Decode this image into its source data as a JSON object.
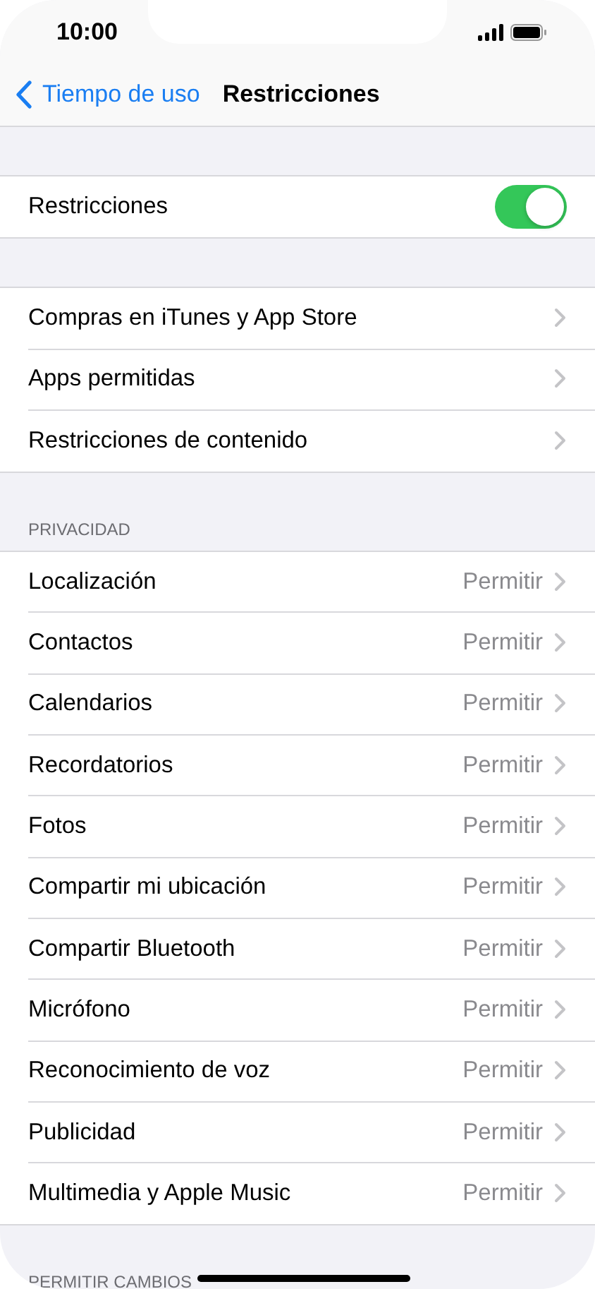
{
  "status_bar": {
    "time": "10:00"
  },
  "nav": {
    "back": "Tiempo de uso",
    "title": "Restricciones"
  },
  "sections": [
    {
      "rows": [
        {
          "kind": "toggle",
          "label": "Restricciones",
          "on": true
        }
      ]
    },
    {
      "rows": [
        {
          "kind": "link",
          "label": "Compras en iTunes y App Store"
        },
        {
          "kind": "link",
          "label": "Apps permitidas"
        },
        {
          "kind": "link",
          "label": "Restricciones de contenido"
        }
      ]
    },
    {
      "header": "PRIVACIDAD",
      "rows": [
        {
          "kind": "link",
          "label": "Localización",
          "value": "Permitir"
        },
        {
          "kind": "link",
          "label": "Contactos",
          "value": "Permitir"
        },
        {
          "kind": "link",
          "label": "Calendarios",
          "value": "Permitir"
        },
        {
          "kind": "link",
          "label": "Recordatorios",
          "value": "Permitir"
        },
        {
          "kind": "link",
          "label": "Fotos",
          "value": "Permitir"
        },
        {
          "kind": "link",
          "label": "Compartir mi ubicación",
          "value": "Permitir"
        },
        {
          "kind": "link",
          "label": "Compartir Bluetooth",
          "value": "Permitir"
        },
        {
          "kind": "link",
          "label": "Micrófono",
          "value": "Permitir"
        },
        {
          "kind": "link",
          "label": "Reconocimiento de voz",
          "value": "Permitir"
        },
        {
          "kind": "link",
          "label": "Publicidad",
          "value": "Permitir"
        },
        {
          "kind": "link",
          "label": "Multimedia y Apple Music",
          "value": "Permitir"
        }
      ]
    },
    {
      "header": "PERMITIR CAMBIOS"
    }
  ]
}
